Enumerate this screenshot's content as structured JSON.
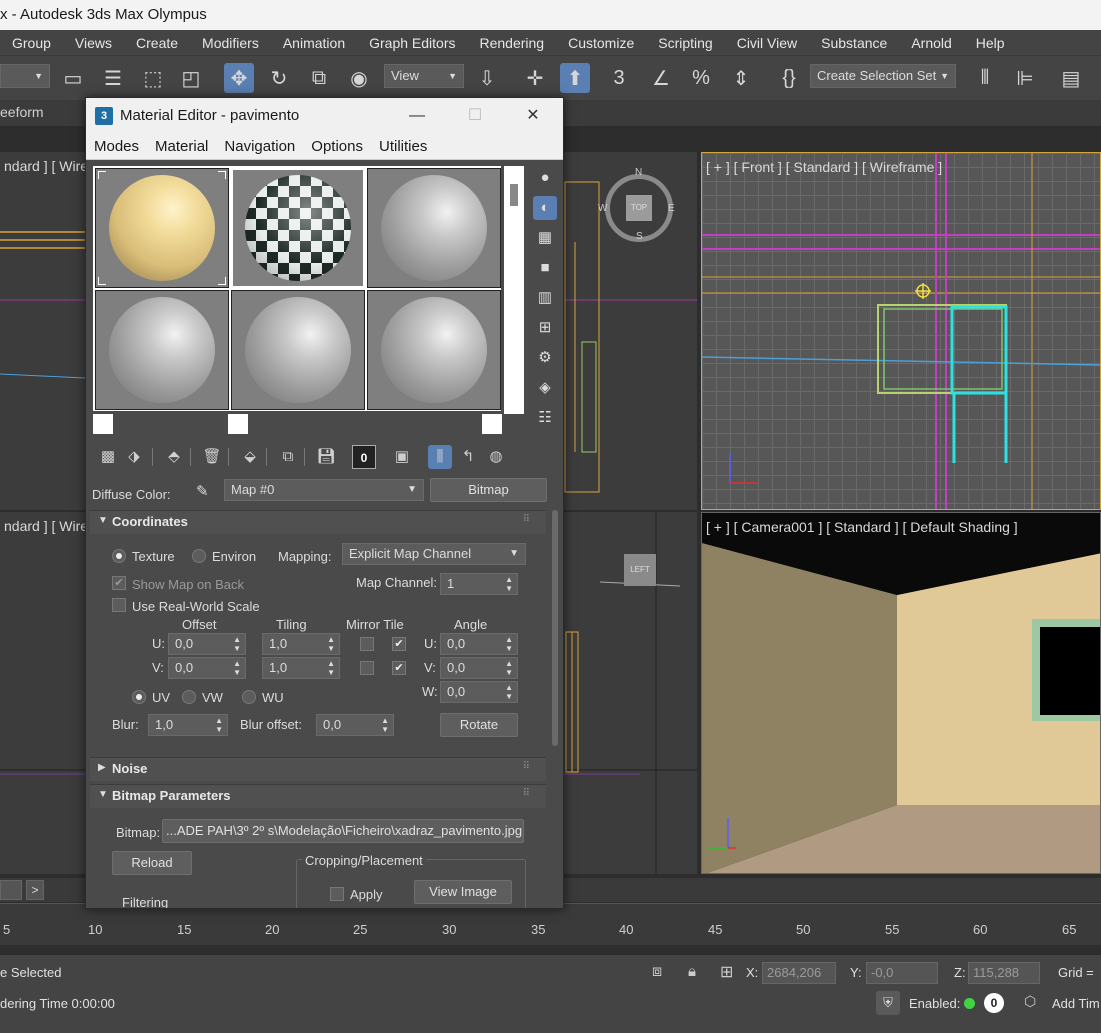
{
  "app": {
    "title": "x - Autodesk 3ds Max Olympus"
  },
  "menu": [
    "Group",
    "Views",
    "Create",
    "Modifiers",
    "Animation",
    "Graph Editors",
    "Rendering",
    "Customize",
    "Scripting",
    "Civil View",
    "Substance",
    "Arnold",
    "Help"
  ],
  "toolbar": {
    "view_dropdown": "View",
    "selection_set": "Create Selection Set"
  },
  "ribbon": {
    "tab": "eeform"
  },
  "viewports": {
    "top_left": "ndard ] [ Wirefi",
    "top_right": "[ + ] [ Front ] [ Standard ] [ Wireframe ]",
    "bottom_left": "ndard ] [ Wirefi",
    "bottom_right": "[ + ] [ Camera001 ] [ Standard ] [ Default Shading ]",
    "viewcube_top": "TOP",
    "viewcube_left": "LEFT",
    "compass": {
      "n": "N",
      "s": "S",
      "e": "E",
      "w": "W"
    },
    "axis": {
      "x": "x",
      "y": "y",
      "z": "z"
    }
  },
  "timeline": {
    "ticks": [
      "5",
      "10",
      "15",
      "20",
      "25",
      "30",
      "35",
      "40",
      "45",
      "50",
      "55",
      "60",
      "65"
    ],
    "next": ">"
  },
  "status": {
    "selection": "e Selected",
    "render_time": "dering Time  0:00:00",
    "x_label": "X:",
    "x_value": "2684,206",
    "y_label": "Y:",
    "y_value": "-0,0",
    "z_label": "Z:",
    "z_value": "115,288",
    "grid": "Grid =",
    "enabled_label": "Enabled:",
    "enabled_count": "0",
    "add_time": "Add Tim"
  },
  "material_editor": {
    "icon": "3",
    "title": "Material Editor - pavimento",
    "menu": [
      "Modes",
      "Material",
      "Navigation",
      "Options",
      "Utilities"
    ],
    "toolbar_zero": "0",
    "diffuse_label": "Diffuse Color:",
    "map_name": "Map #0",
    "map_type": "Bitmap",
    "coordinates": {
      "title": "Coordinates",
      "texture": "Texture",
      "environ": "Environ",
      "mapping_label": "Mapping:",
      "mapping_value": "Explicit Map Channel",
      "show_map_on_back": "Show Map on Back",
      "map_channel_label": "Map Channel:",
      "map_channel_value": "1",
      "real_world": "Use Real-World Scale",
      "offset": "Offset",
      "tiling": "Tiling",
      "mirror_tile": "Mirror Tile",
      "angle": "Angle",
      "u_label": "U:",
      "v_label": "V:",
      "w_label": "W:",
      "u_offset": "0,0",
      "v_offset": "0,0",
      "u_tiling": "1,0",
      "v_tiling": "1,0",
      "u_angle": "0,0",
      "v_angle": "0,0",
      "w_angle": "0,0",
      "uv": "UV",
      "vw": "VW",
      "wu": "WU",
      "blur_label": "Blur:",
      "blur_value": "1,0",
      "blur_offset_label": "Blur offset:",
      "blur_offset_value": "0,0",
      "rotate": "Rotate"
    },
    "noise": {
      "title": "Noise"
    },
    "bitmap_params": {
      "title": "Bitmap Parameters",
      "bitmap_label": "Bitmap:",
      "bitmap_path": "...ADE PAH\\3º 2º s\\Modelação\\Ficheiro\\xadraz_pavimento.jpg",
      "reload": "Reload",
      "cropping": "Cropping/Placement",
      "apply": "Apply",
      "view_image": "View Image",
      "filtering": "Filtering"
    }
  },
  "colors": {
    "accent": "#5a7fb3",
    "viewport_border": "#d1a43c"
  }
}
